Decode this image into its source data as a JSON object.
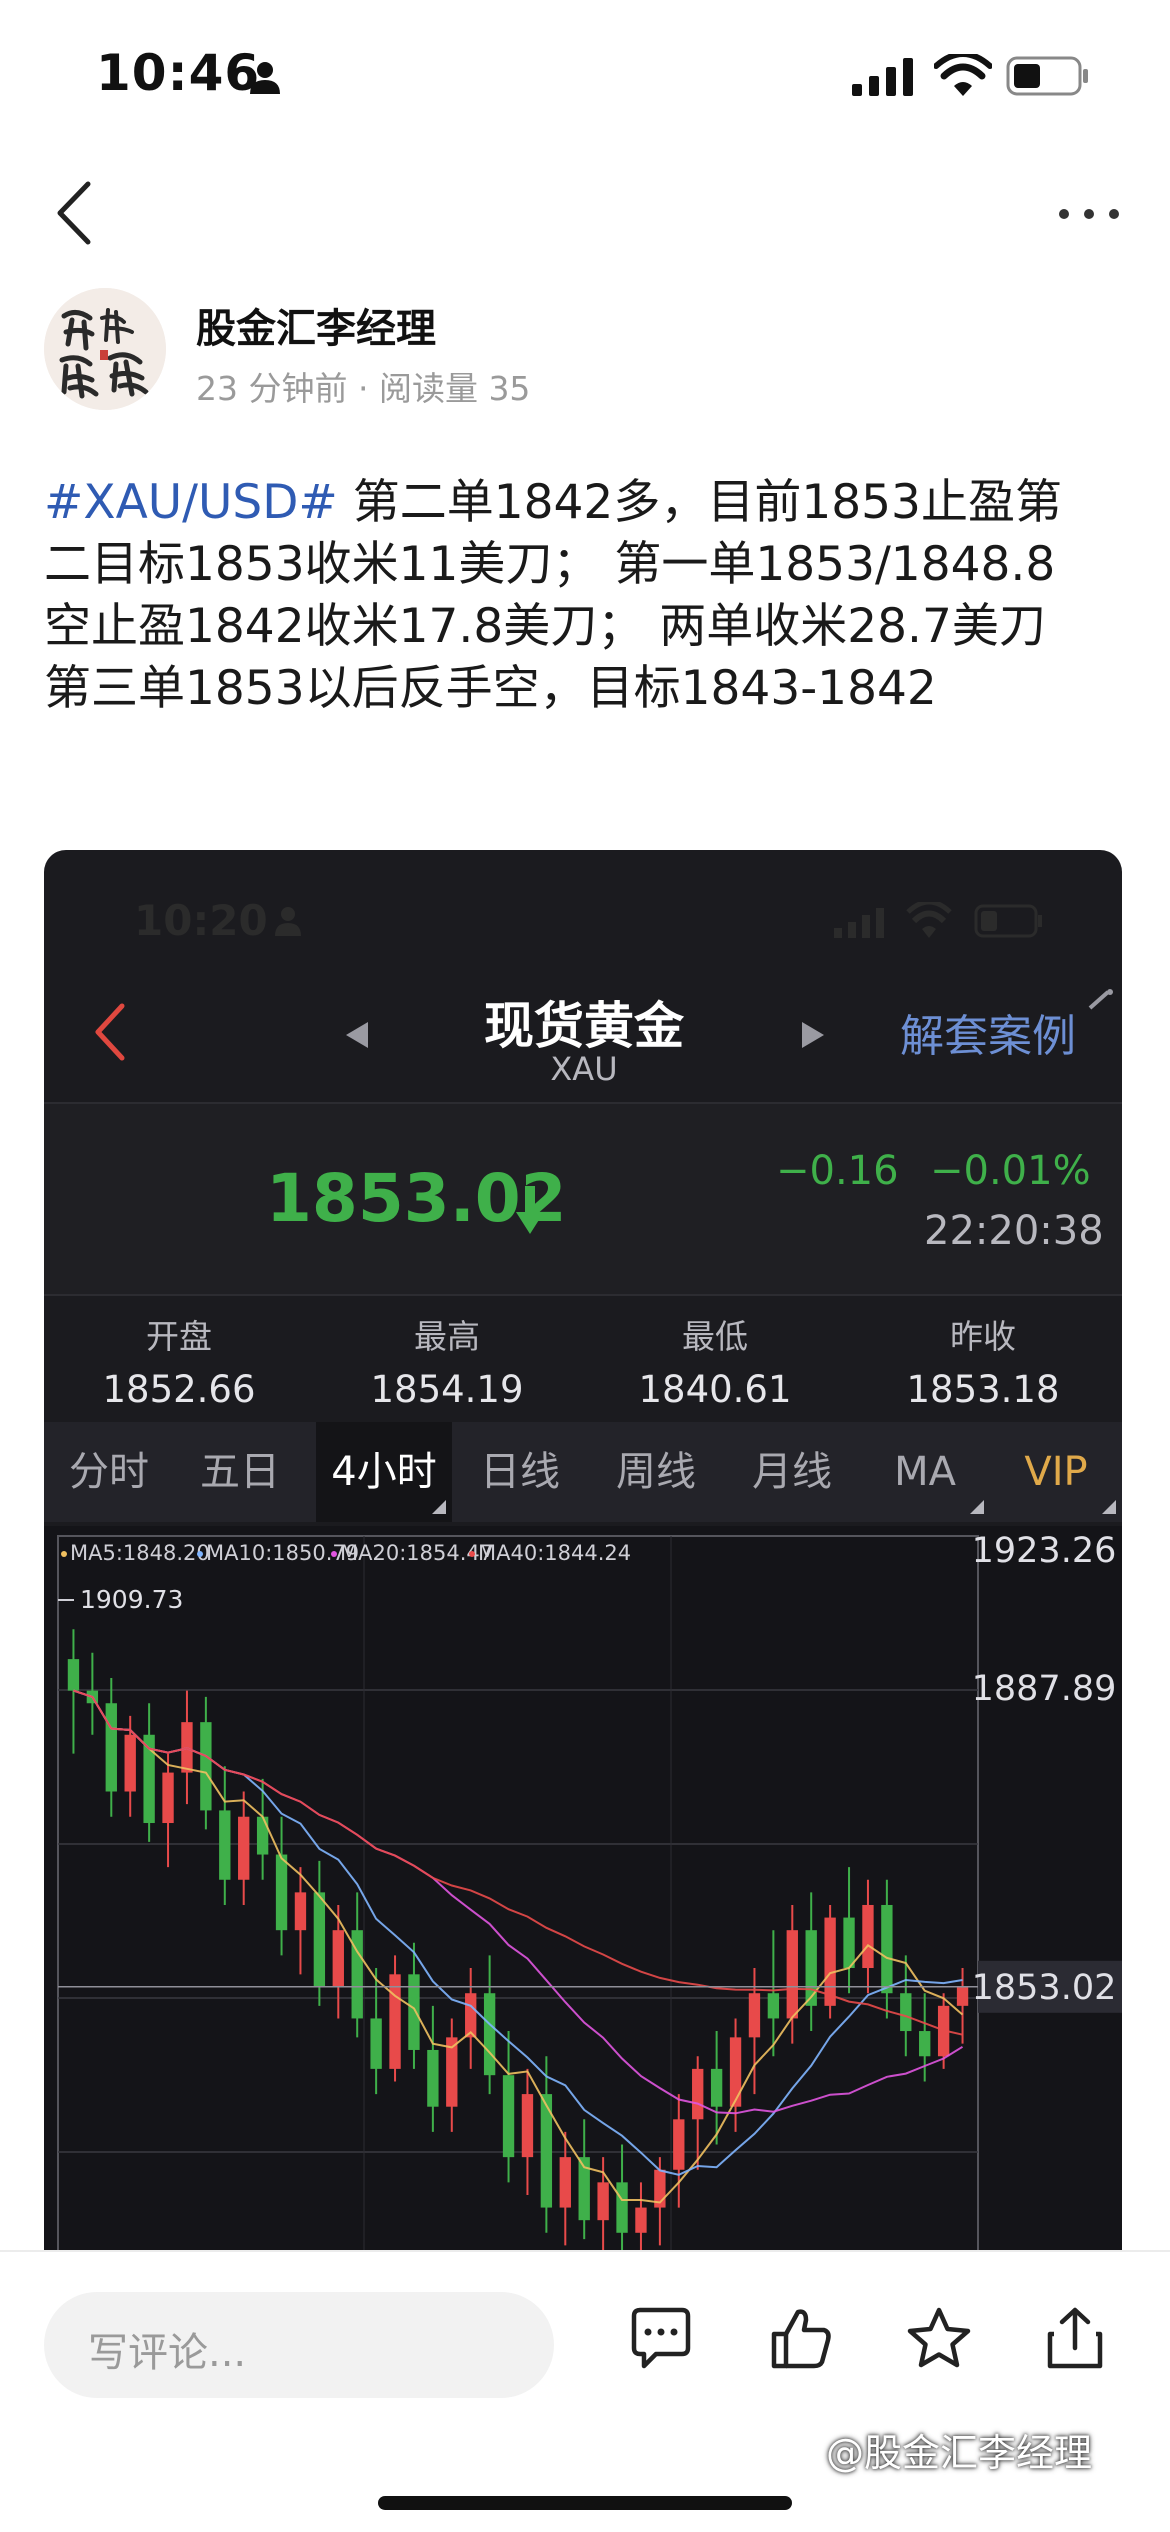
{
  "status_bar": {
    "time": "10:46"
  },
  "author": {
    "name": "股金汇李经理",
    "meta": "23 分钟前 · 阅读量 35"
  },
  "post": {
    "hashtag": "#XAU/USD#",
    "lines": [
      " 第二单1842多，目前1853止盈第",
      "二目标1853收米11美刀； 第一单1853/1848.8",
      "空止盈1842收米17.8美刀； 两单收米28.7美刀",
      "第三单1853以后反手空，目标1843-1842"
    ]
  },
  "embedded_screenshot": {
    "status_time": "10:20",
    "title": "现货黄金",
    "subtitle": "XAU",
    "case_link": "解套案例",
    "price": "1853.02",
    "change": "−0.16",
    "change_pct": "−0.01%",
    "quote_time": "22:20:38",
    "stats": [
      {
        "label": "开盘",
        "value": "1852.66"
      },
      {
        "label": "最高",
        "value": "1854.19"
      },
      {
        "label": "最低",
        "value": "1840.61"
      },
      {
        "label": "昨收",
        "value": "1853.18"
      }
    ],
    "tabs": [
      "分时",
      "五日",
      "4小时",
      "日线",
      "周线",
      "月线",
      "MA",
      "VIP"
    ],
    "active_tab": "4小时",
    "colors": {
      "up": "#e84a4a",
      "down": "#3fb04a",
      "accent": "#6d8fd4",
      "vip": "#e0a94a"
    }
  },
  "chart_data": {
    "type": "candlestick",
    "ma_legend": [
      {
        "label": "MA5:1848.20",
        "color": "#f0c060"
      },
      {
        "label": "MA10:1850.79",
        "color": "#7fb5ff"
      },
      {
        "label": "MA20:1854.47",
        "color": "#e055e0"
      },
      {
        "label": "MA40:1844.24",
        "color": "#e84a4a"
      }
    ],
    "y_labels": [
      "1923.26",
      "1887.89",
      "1853.02"
    ],
    "annotation": "1909.73",
    "y_range": [
      1810,
      1923.26
    ],
    "current_price": 1853.02,
    "candles": [
      [
        1905,
        1909.73,
        1890,
        1900
      ],
      [
        1900,
        1906,
        1893,
        1898
      ],
      [
        1898,
        1902,
        1880,
        1884
      ],
      [
        1884,
        1896,
        1880,
        1893
      ],
      [
        1893,
        1898,
        1876,
        1879
      ],
      [
        1879,
        1890,
        1872,
        1887
      ],
      [
        1887,
        1900,
        1882,
        1895
      ],
      [
        1895,
        1899,
        1878,
        1881
      ],
      [
        1881,
        1888,
        1866,
        1870
      ],
      [
        1870,
        1884,
        1866,
        1880
      ],
      [
        1880,
        1886,
        1870,
        1874
      ],
      [
        1874,
        1880,
        1858,
        1862
      ],
      [
        1862,
        1872,
        1855,
        1868
      ],
      [
        1868,
        1873,
        1850,
        1853
      ],
      [
        1853,
        1866,
        1848,
        1862
      ],
      [
        1862,
        1868,
        1845,
        1848
      ],
      [
        1848,
        1856,
        1836,
        1840
      ],
      [
        1840,
        1858,
        1838,
        1855
      ],
      [
        1855,
        1860,
        1840,
        1843
      ],
      [
        1843,
        1850,
        1830,
        1834
      ],
      [
        1834,
        1848,
        1830,
        1845
      ],
      [
        1845,
        1856,
        1840,
        1852
      ],
      [
        1852,
        1858,
        1836,
        1839
      ],
      [
        1839,
        1846,
        1822,
        1826
      ],
      [
        1826,
        1840,
        1820,
        1836
      ],
      [
        1836,
        1842,
        1814,
        1818
      ],
      [
        1818,
        1830,
        1812,
        1826
      ],
      [
        1826,
        1832,
        1813,
        1816
      ],
      [
        1816,
        1826,
        1811,
        1822
      ],
      [
        1822,
        1828,
        1811,
        1814
      ],
      [
        1814,
        1822,
        1811,
        1818
      ],
      [
        1818,
        1826,
        1812,
        1824
      ],
      [
        1824,
        1836,
        1818,
        1832
      ],
      [
        1832,
        1842,
        1824,
        1840
      ],
      [
        1840,
        1846,
        1828,
        1834
      ],
      [
        1834,
        1848,
        1830,
        1845
      ],
      [
        1845,
        1856,
        1836,
        1852
      ],
      [
        1852,
        1862,
        1842,
        1848
      ],
      [
        1848,
        1866,
        1844,
        1862
      ],
      [
        1862,
        1868,
        1846,
        1850
      ],
      [
        1850,
        1866,
        1848,
        1864
      ],
      [
        1864,
        1872,
        1852,
        1856
      ],
      [
        1856,
        1870,
        1852,
        1866
      ],
      [
        1866,
        1870,
        1848,
        1852
      ],
      [
        1852,
        1858,
        1842,
        1846
      ],
      [
        1846,
        1852,
        1838,
        1842
      ],
      [
        1842,
        1852,
        1840,
        1850
      ],
      [
        1850,
        1856,
        1844,
        1853.02
      ]
    ]
  },
  "bottom_bar": {
    "comment_placeholder": "写评论...",
    "watermark": "@股金汇李经理"
  }
}
